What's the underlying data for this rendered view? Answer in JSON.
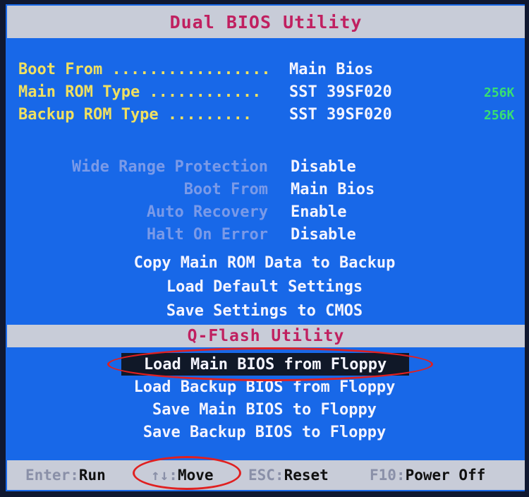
{
  "title": "Dual BIOS Utility",
  "info": [
    {
      "label": "Boot From .................",
      "value": "Main Bios",
      "size": ""
    },
    {
      "label": "Main ROM Type ............",
      "value": "SST 39SF020",
      "size": "256K"
    },
    {
      "label": "Backup ROM Type .........",
      "value": "SST 39SF020",
      "size": "256K"
    }
  ],
  "options": [
    {
      "label": "Wide Range Protection",
      "value": "Disable"
    },
    {
      "label": "Boot From",
      "value": "Main Bios"
    },
    {
      "label": "Auto Recovery",
      "value": "Enable"
    },
    {
      "label": "Halt On Error",
      "value": "Disable"
    }
  ],
  "actions": [
    "Copy Main ROM Data to Backup",
    "Load Default Settings",
    "Save Settings to CMOS"
  ],
  "qflash_title": "Q-Flash Utility",
  "qflash_items": [
    "Load Main BIOS from Floppy",
    "Load Backup BIOS from Floppy",
    "Save Main BIOS to Floppy",
    "Save Backup BIOS to Floppy"
  ],
  "selected_qflash_index": 0,
  "status": [
    {
      "key": "Enter:",
      "action": "Run"
    },
    {
      "key": "↑↓:",
      "action": "Move"
    },
    {
      "key": "ESC:",
      "action": "Reset"
    },
    {
      "key": "F10:",
      "action": "Power Off"
    }
  ],
  "colors": {
    "background": "#1868e8",
    "title_text": "#c02060",
    "info_label": "#f0e060",
    "size_text": "#38e070",
    "annotation": "#e02020"
  }
}
